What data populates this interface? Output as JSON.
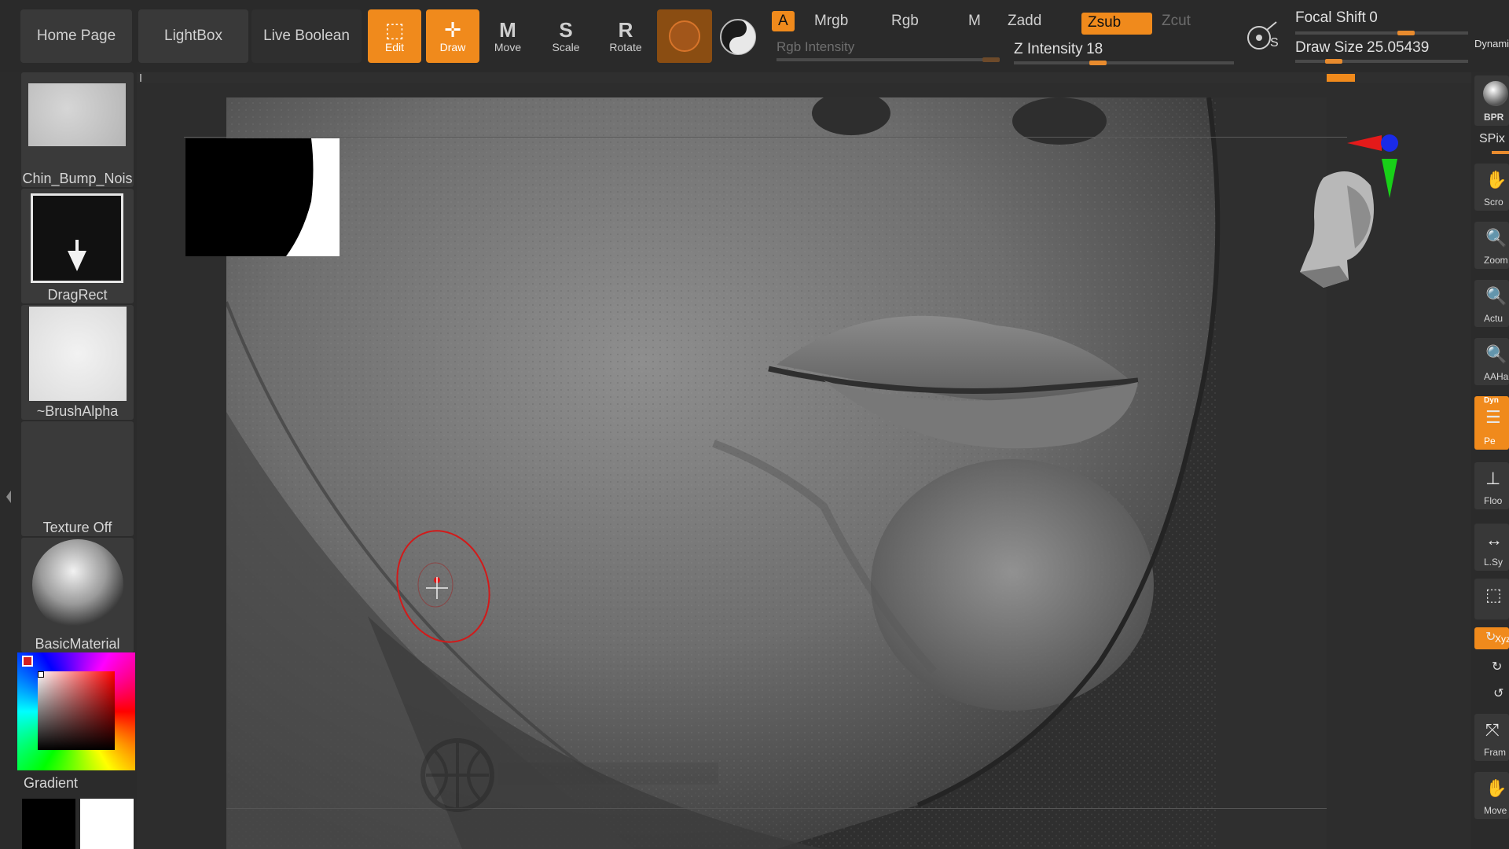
{
  "topbar": {
    "tabs": [
      "Home Page",
      "LightBox",
      "Live Boolean"
    ],
    "tools": {
      "edit": {
        "glyph": "⬚",
        "label": "Edit"
      },
      "draw": {
        "glyph": "✛",
        "label": "Draw"
      },
      "move": {
        "glyph": "M",
        "label": "Move"
      },
      "scale": {
        "glyph": "S",
        "label": "Scale"
      },
      "rotate": {
        "glyph": "R",
        "label": "Rotate"
      }
    },
    "modes": {
      "a": "A",
      "mrgb": "Mrgb",
      "rgb": "Rgb",
      "m": "M",
      "zadd": "Zadd",
      "zsub": "Zsub",
      "zcut": "Zcut"
    },
    "rgb_intensity_label": "Rgb Intensity",
    "z_intensity_label": "Z Intensity",
    "z_intensity_value": "18",
    "focal_shift_label": "Focal Shift",
    "focal_shift_value": "0",
    "draw_size_label": "Draw Size",
    "draw_size_value": "25.05439",
    "dynamic_label": "Dynami",
    "lightbox_icon": "S"
  },
  "leftshelf": {
    "alpha_name": "Chin_Bump_Nois",
    "stroke_name": "DragRect",
    "brush_alpha_name": "~BrushAlpha",
    "texture_name": "Texture Off",
    "material_name": "BasicMaterial",
    "gradient_label": "Gradient"
  },
  "rightshelf": {
    "items": [
      {
        "icon": "●",
        "label": "BPR"
      },
      {
        "icon": "",
        "label": "SPix"
      },
      {
        "icon": "✋",
        "label": "Scro"
      },
      {
        "icon": "🔍",
        "label": "Zoom"
      },
      {
        "icon": "🔍",
        "label": "Actu"
      },
      {
        "icon": "🔍",
        "label": "AAHa"
      },
      {
        "icon": "☰",
        "label": "Pe"
      },
      {
        "icon": "⊥",
        "label": "Floo"
      },
      {
        "icon": "↔",
        "label": "L.Sy"
      },
      {
        "icon": "⬚",
        "label": ""
      },
      {
        "icon": "↻",
        "label": "Xyz"
      },
      {
        "icon": "⤧",
        "label": "Fram"
      },
      {
        "icon": "✋",
        "label": "Move"
      }
    ],
    "dynamic_badge": "Dyn"
  },
  "colors": {
    "accent": "#f08a1c",
    "panel": "#3a3a3a",
    "background": "#2b2b2b",
    "brush_cursor": "#d21a1a"
  }
}
